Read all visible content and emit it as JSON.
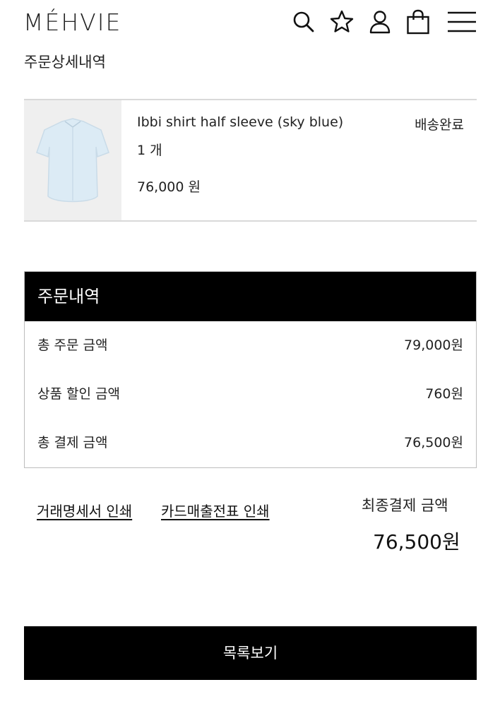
{
  "header": {
    "logo": "MÉHVIE",
    "icons": [
      "search-icon",
      "star-icon",
      "user-icon",
      "shopping-bag-icon",
      "menu-icon"
    ]
  },
  "page": {
    "title": "주문상세내역"
  },
  "order_item": {
    "name": "Ibbi shirt half sleeve (sky blue)",
    "quantity": "1 개",
    "price": "76,000 원",
    "status": "배송완료"
  },
  "summary": {
    "title": "주문내역",
    "rows": [
      {
        "label": "총 주문 금액",
        "value": "79,000원"
      },
      {
        "label": "상품 할인 금액",
        "value": "760원"
      },
      {
        "label": "총 결제 금액",
        "value": "76,500원"
      }
    ]
  },
  "actions": {
    "print_statement": "거래명세서 인쇄",
    "print_card_receipt": "카드매출전표 인쇄",
    "final_label": "최종결제 금액",
    "final_amount": "76,500원",
    "list_button": "목록보기"
  },
  "colors": {
    "accent": "#000000",
    "thumb_bg": "#efefef",
    "border": "#d9d9d9"
  }
}
